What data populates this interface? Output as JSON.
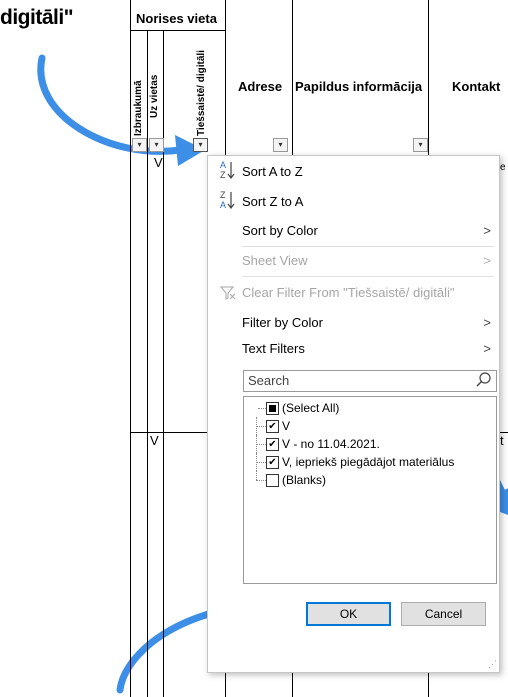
{
  "caption": "digitāli\"",
  "sheet": {
    "group_header": "Norises vieta",
    "col_izbraukuma": "Izbraukumā",
    "col_uz_vietas": "Uz vietas",
    "col_tiessaiste": "Tiešsaistē/ digitāli",
    "col_adrese": "Adrese",
    "col_papildus": "Papildus informācija",
    "col_kontakt": "Kontakt",
    "filter_glyph": "▾",
    "cell_v_top": "V",
    "cell_v_lower": "V",
    "edge_chars": [
      "e",
      "t"
    ]
  },
  "menu": {
    "sort_az": "Sort A to Z",
    "sort_za": "Sort Z to A",
    "sort_by_color": "Sort by Color",
    "sheet_view": "Sheet View",
    "clear_filter": "Clear Filter From \"Tiešsaistē/ digitāli\"",
    "filter_by_color": "Filter by Color",
    "text_filters": "Text Filters",
    "search_placeholder": "Search",
    "arrow": ">",
    "items": [
      {
        "label": "(Select All)",
        "state": "partial"
      },
      {
        "label": "V",
        "state": "checked"
      },
      {
        "label": "V - no 11.04.2021.",
        "state": "checked"
      },
      {
        "label": "V, iepriekš piegādājot materiālus",
        "state": "checked"
      },
      {
        "label": "(Blanks)",
        "state": "unchecked"
      }
    ],
    "ok": "OK",
    "cancel": "Cancel"
  },
  "icons": {
    "sort_az": "sort-a-to-z-icon",
    "sort_za": "sort-z-to-a-icon",
    "clear_filter": "clear-filter-icon",
    "search": "search-icon"
  },
  "colors": {
    "arrow": "#3d8ee6",
    "ok_border": "#0078d7"
  }
}
